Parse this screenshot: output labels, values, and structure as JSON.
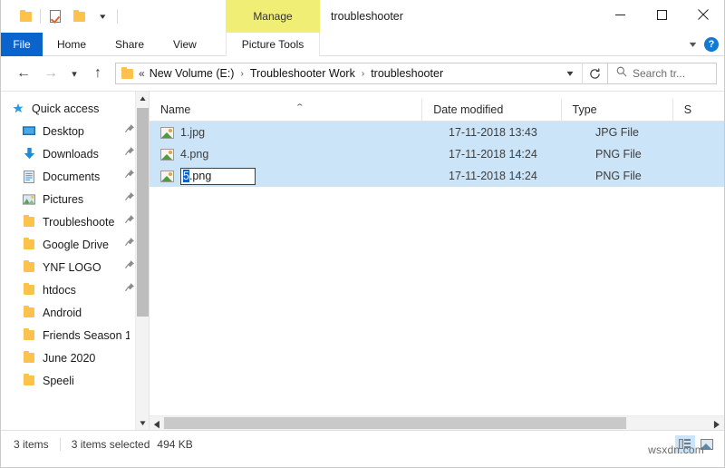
{
  "window": {
    "title": "troubleshooter",
    "quick_access_toolbar": [
      {
        "name": "folder-icon",
        "label": "Properties folder"
      },
      {
        "name": "properties-icon",
        "label": "Properties"
      },
      {
        "name": "new-folder-icon",
        "label": "New folder"
      },
      {
        "name": "customize-caret",
        "label": "Customize Quick Access Toolbar"
      }
    ],
    "controls": {
      "minimize": "Minimize",
      "maximize": "Maximize",
      "close": "Close"
    }
  },
  "ribbon": {
    "contextual_group": "Manage",
    "contextual_group_color": "#f0ee74",
    "tabs": [
      {
        "label": "File",
        "active": true
      },
      {
        "label": "Home",
        "active": false
      },
      {
        "label": "Share",
        "active": false
      },
      {
        "label": "View",
        "active": false
      }
    ],
    "contextual_tab": "Picture Tools",
    "expand_label": "Expand the Ribbon",
    "help_label": "?",
    "file_tab_color": "#0b63ce"
  },
  "address_bar": {
    "back": "Back",
    "forward": "Forward",
    "recent": "Recent locations",
    "up": "Up",
    "breadcrumbs": [
      {
        "label": "New Volume (E:)"
      },
      {
        "label": "Troubleshooter Work"
      },
      {
        "label": "troubleshooter"
      }
    ],
    "overflow_glyph": "«",
    "separator": "›",
    "dropdown": "Previous locations",
    "refresh": "Refresh",
    "search": {
      "placeholder": "Search tr...",
      "icon": "search-icon"
    }
  },
  "sidebar": {
    "items": [
      {
        "label": "Quick access",
        "icon": "star-icon",
        "pinned": false,
        "root": true
      },
      {
        "label": "Desktop",
        "icon": "desktop-icon",
        "pinned": true
      },
      {
        "label": "Downloads",
        "icon": "download-icon",
        "pinned": true
      },
      {
        "label": "Documents",
        "icon": "documents-icon",
        "pinned": true
      },
      {
        "label": "Pictures",
        "icon": "pictures-icon",
        "pinned": true
      },
      {
        "label": "Troubleshoote",
        "icon": "folder-icon",
        "pinned": true
      },
      {
        "label": "Google Drive",
        "icon": "folder-icon",
        "pinned": true
      },
      {
        "label": "YNF LOGO",
        "icon": "folder-icon",
        "pinned": true
      },
      {
        "label": "htdocs",
        "icon": "folder-icon",
        "pinned": true
      },
      {
        "label": "Android",
        "icon": "folder-icon",
        "pinned": false
      },
      {
        "label": "Friends Season 1",
        "icon": "folder-icon",
        "pinned": false
      },
      {
        "label": "June 2020",
        "icon": "folder-icon",
        "pinned": false
      },
      {
        "label": "Speeli",
        "icon": "folder-icon",
        "pinned": false
      }
    ]
  },
  "file_list": {
    "columns": [
      {
        "label": "Name",
        "sorted": "asc"
      },
      {
        "label": "Date modified",
        "sorted": ""
      },
      {
        "label": "Type",
        "sorted": ""
      },
      {
        "label": "S",
        "sorted": ""
      }
    ],
    "sort_caret": "⌃",
    "rows": [
      {
        "name": "1.jpg",
        "date_modified": "17-11-2018 13:43",
        "type": "JPG File",
        "selected": true,
        "renaming": false
      },
      {
        "name": "4.png",
        "date_modified": "17-11-2018 14:24",
        "type": "PNG File",
        "selected": true,
        "renaming": false
      },
      {
        "name": "5.png",
        "date_modified": "17-11-2018 14:24",
        "type": "PNG File",
        "selected": true,
        "renaming": true,
        "rename_selected_text": "5",
        "rename_trailing_text": ".png"
      }
    ],
    "selection_color": "#cce4f7"
  },
  "status_bar": {
    "item_count": "3 items",
    "selection_count": "3 items selected",
    "selection_size": "494 KB",
    "view_buttons": [
      {
        "name": "details-view-button",
        "label": "Details view",
        "active": true
      },
      {
        "name": "large-icons-view-button",
        "label": "Large icons view",
        "active": false
      }
    ]
  },
  "watermark": {
    "text": "wsxdn.com"
  }
}
